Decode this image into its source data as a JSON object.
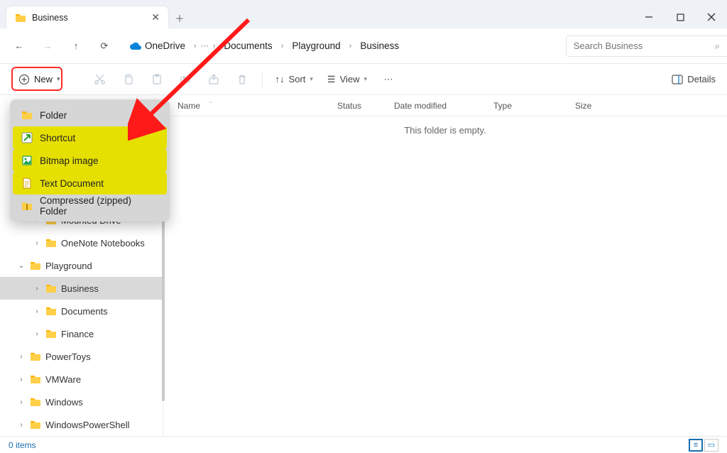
{
  "tab": {
    "title": "Business"
  },
  "crumbs": [
    "OneDrive",
    "Documents",
    "Playground",
    "Business"
  ],
  "search": {
    "placeholder": "Search Business"
  },
  "toolbar": {
    "new": "New",
    "sort": "Sort",
    "view": "View",
    "details": "Details"
  },
  "dropdown": {
    "items": [
      {
        "label": "Folder",
        "hl": false,
        "icon": "folder"
      },
      {
        "label": "Shortcut",
        "hl": true,
        "icon": "shortcut"
      },
      {
        "label": "Bitmap image",
        "hl": true,
        "icon": "bitmap"
      },
      {
        "label": "Text Document",
        "hl": true,
        "icon": "text"
      },
      {
        "label": "Compressed (zipped) Folder",
        "hl": false,
        "icon": "zip"
      }
    ]
  },
  "columns": {
    "name": "Name",
    "status": "Status",
    "date": "Date modified",
    "type": "Type",
    "size": "Size"
  },
  "emptyMsg": "This folder is empty.",
  "tree": [
    {
      "label": "Mounted Drive",
      "tw": ">",
      "cls": "child"
    },
    {
      "label": "OneNote Notebooks",
      "tw": ">",
      "cls": "child"
    },
    {
      "label": "Playground",
      "tw": "v",
      "cls": "row"
    },
    {
      "label": "Business",
      "tw": ">",
      "cls": "child sel"
    },
    {
      "label": "Documents",
      "tw": ">",
      "cls": "child"
    },
    {
      "label": "Finance",
      "tw": ">",
      "cls": "child"
    },
    {
      "label": "PowerToys",
      "tw": ">",
      "cls": "row"
    },
    {
      "label": "VMWare",
      "tw": ">",
      "cls": "row"
    },
    {
      "label": "Windows",
      "tw": ">",
      "cls": "row"
    },
    {
      "label": "WindowsPowerShell",
      "tw": ">",
      "cls": "row"
    }
  ],
  "status": {
    "count": "0 items"
  }
}
